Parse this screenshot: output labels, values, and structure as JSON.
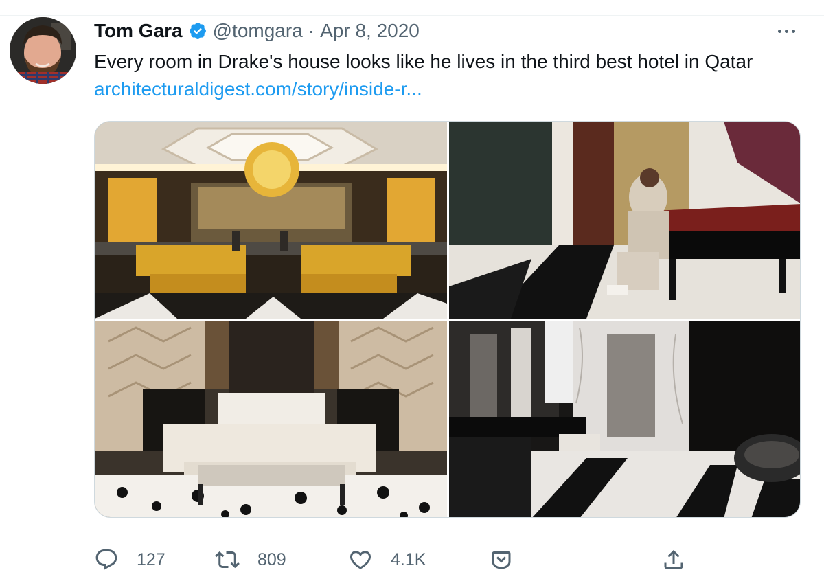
{
  "tweet": {
    "author_name": "Tom Gara",
    "handle": "@tomgara",
    "separator": "·",
    "date": "Apr 8, 2020",
    "text": "Every room in Drake's house looks like he lives in the third best hotel in Qatar ",
    "link_text": "architecturaldigest.com/story/inside-r...",
    "media_count": 4
  },
  "actions": {
    "reply_count": "127",
    "retweet_count": "809",
    "like_count": "4.1K"
  },
  "icons": {
    "verified": "verified-badge-icon",
    "more": "more-options-icon",
    "reply": "reply-icon",
    "retweet": "retweet-icon",
    "like": "heart-icon",
    "share": "share-icon",
    "upload": "upload-icon"
  },
  "colors": {
    "accent": "#1d9bf0",
    "text_primary": "#0f1419",
    "text_secondary": "#536471",
    "border": "#cfd9de"
  }
}
